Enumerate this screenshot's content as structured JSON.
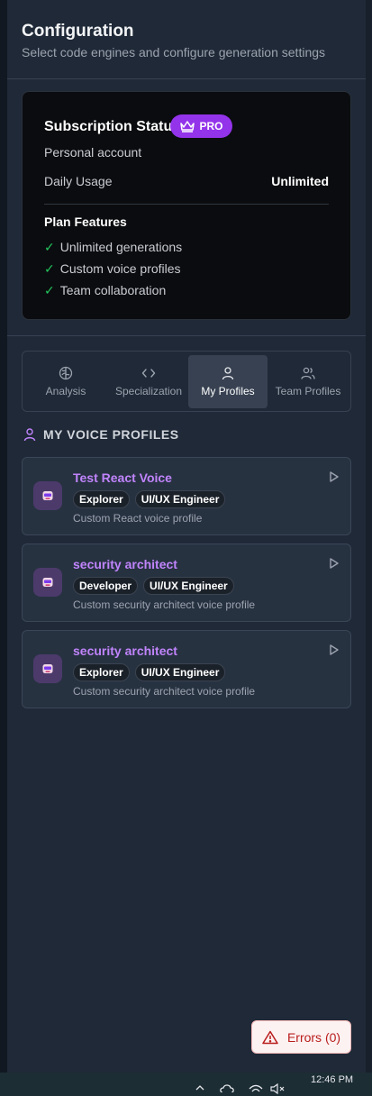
{
  "header": {
    "title": "Configuration",
    "subtitle": "Select code engines and configure generation settings"
  },
  "subscription": {
    "title": "Subscription Status",
    "badge": "PRO",
    "account": "Personal account",
    "usage_label": "Daily Usage",
    "usage_value": "Unlimited",
    "features_title": "Plan Features",
    "features": [
      "Unlimited generations",
      "Custom voice profiles",
      "Team collaboration"
    ],
    "check": "✓"
  },
  "tabs": [
    {
      "label": "Analysis",
      "icon": "brain-icon",
      "active": false
    },
    {
      "label": "Specialization",
      "icon": "code-icon",
      "active": false
    },
    {
      "label": "My Profiles",
      "icon": "user-icon",
      "active": true
    },
    {
      "label": "Team Profiles",
      "icon": "users-icon",
      "active": false
    }
  ],
  "profiles_section": {
    "title": "MY VOICE PROFILES",
    "icon": "user-icon"
  },
  "profiles": [
    {
      "name": "Test React Voice",
      "tags": [
        "Explorer",
        "UI/UX Engineer"
      ],
      "description": "Custom React voice profile"
    },
    {
      "name": "security architect",
      "tags": [
        "Developer",
        "UI/UX Engineer"
      ],
      "description": "Custom security architect voice profile"
    },
    {
      "name": "security architect",
      "tags": [
        "Explorer",
        "UI/UX Engineer"
      ],
      "description": "Custom security architect voice profile"
    }
  ],
  "errors_button": {
    "label": "Errors (0)",
    "icon": "warning-icon"
  },
  "taskbar": {
    "time": "12:46 PM"
  },
  "colors": {
    "accent": "#9333ea",
    "profile_name": "#c084fc",
    "check": "#22c55e",
    "error": "#b91c1c"
  }
}
